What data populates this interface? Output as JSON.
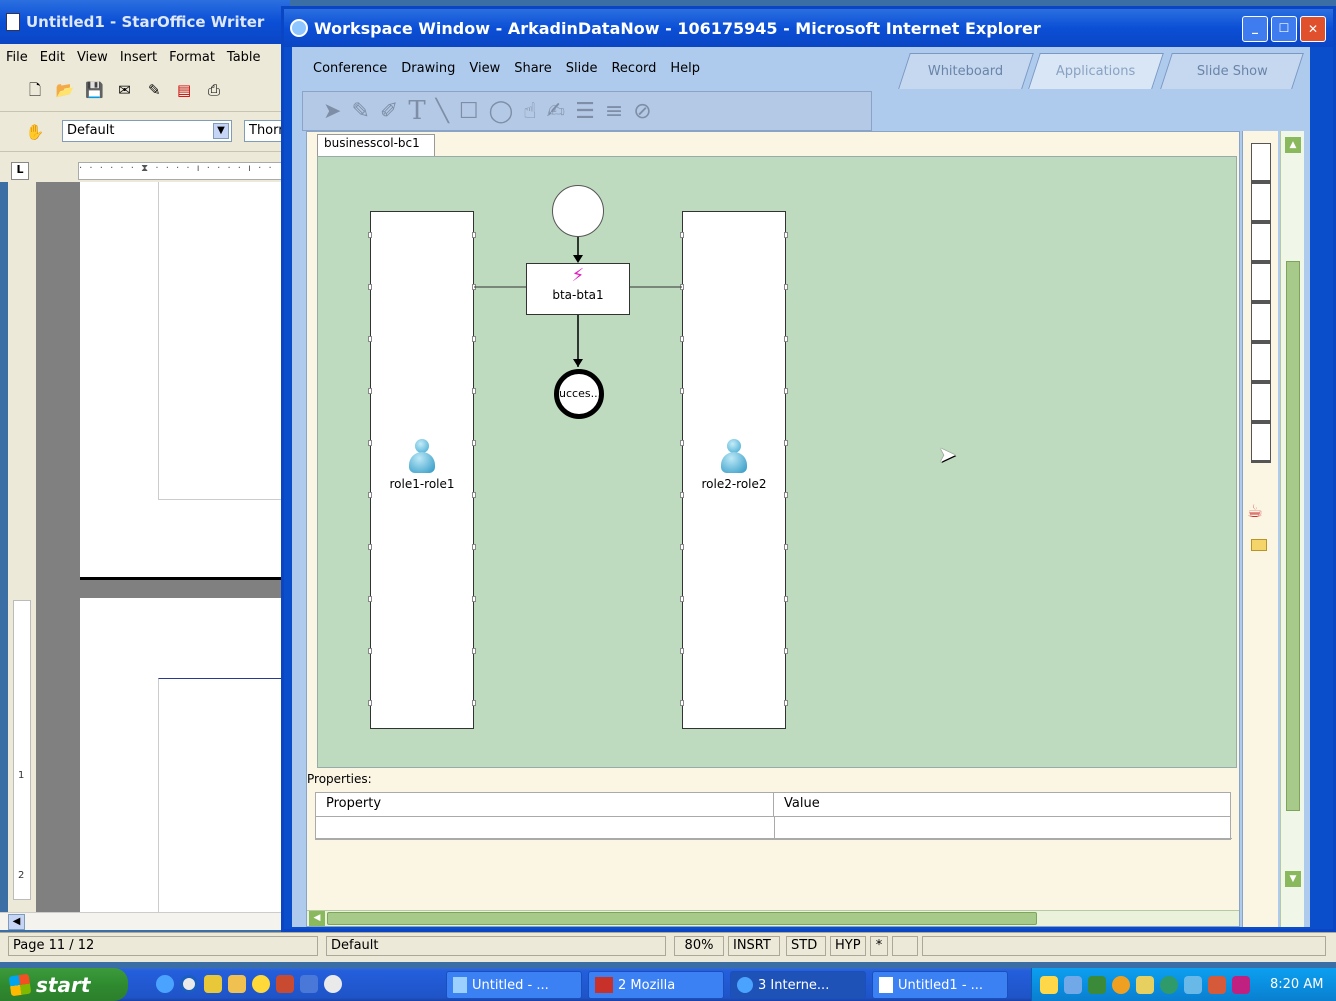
{
  "writer": {
    "title": "Untitled1 - StarOffice Writer",
    "menu": [
      "File",
      "Edit",
      "View",
      "Insert",
      "Format",
      "Table"
    ],
    "style_value": "Default",
    "font_value": "Thorn",
    "ruler_corner": "L",
    "vruler_labels": [
      "1",
      "2"
    ]
  },
  "ie": {
    "title": "Workspace Window - ArkadinDataNow - 106175945 - Microsoft Internet Explorer",
    "menu": [
      "Conference",
      "Drawing",
      "View",
      "Share",
      "Slide",
      "Record",
      "Help"
    ],
    "tabs": [
      "Whiteboard",
      "Applications",
      "Slide Show"
    ],
    "diagram_tab": "businesscol-bc1",
    "lanes": [
      {
        "label": "role1-role1"
      },
      {
        "label": "role2-role2"
      }
    ],
    "task_label": "bta-bta1",
    "end_label": "ucces...",
    "properties_label": "Properties:",
    "prop_headers": [
      "Property",
      "Value"
    ]
  },
  "statusbar": {
    "page": "Page 11 / 12",
    "style": "Default",
    "zoom": "80%",
    "insrt": "INSRT",
    "std": "STD",
    "hyp": "HYP",
    "star": "*"
  },
  "taskbar": {
    "start": "start",
    "tasks": [
      "Untitled - ...",
      "2 Mozilla",
      "3 Interne...",
      "Untitled1 - ..."
    ],
    "time": "8:20 AM"
  }
}
